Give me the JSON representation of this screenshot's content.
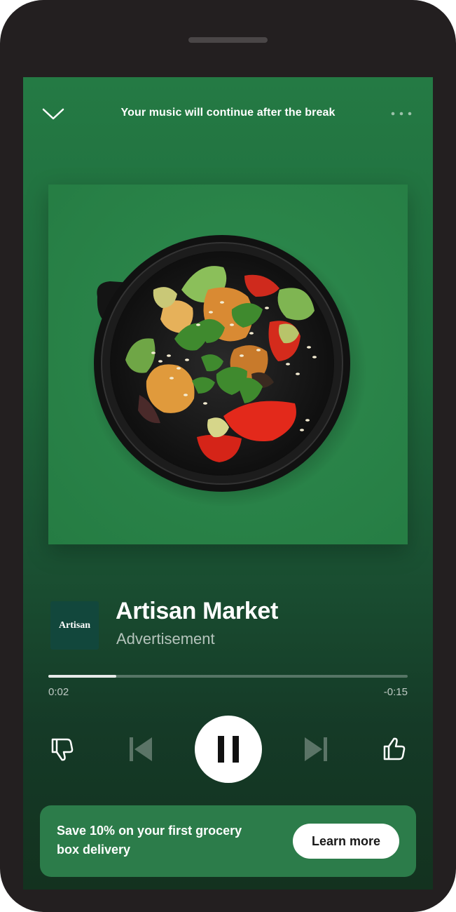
{
  "header": {
    "context_title": "Your music will continue after the break",
    "collapse_icon": "chevron-down-icon",
    "menu_icon": "more-dots-icon"
  },
  "artwork": {
    "description_icon": "salad-bowl-image"
  },
  "track": {
    "brand_logo_text": "Artisan",
    "title": "Artisan Market",
    "subtitle": "Advertisement"
  },
  "progress": {
    "elapsed": "0:02",
    "remaining": "-0:15",
    "fraction": 0.19
  },
  "controls": {
    "dislike_icon": "thumbs-down-icon",
    "previous_icon": "skip-previous-icon",
    "pause_icon": "pause-icon",
    "next_icon": "skip-next-icon",
    "like_icon": "thumbs-up-icon"
  },
  "cta": {
    "text": "Save 10% on your first grocery box delivery",
    "button_label": "Learn more"
  },
  "colors": {
    "background_top": "#247a44",
    "background_bottom": "#13321f",
    "cta_banner": "#2c7c4a",
    "brand_logo_bg": "#12473c"
  }
}
